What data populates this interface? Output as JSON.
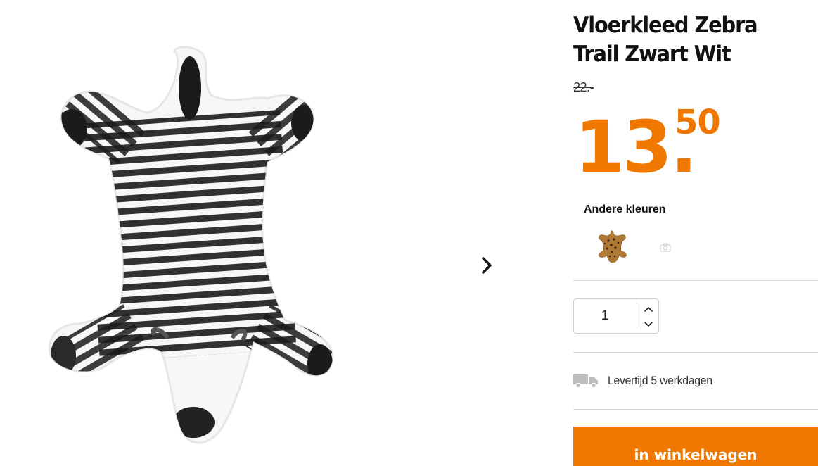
{
  "product": {
    "title": "Vloerkleed Zebra Trail Zwart Wit",
    "old_price": "22.-",
    "price_integer": "13.",
    "price_decimals": "50"
  },
  "colors": {
    "label": "Andere kleuren",
    "swatches": [
      {
        "name": "leopard"
      },
      {
        "name": "no-image"
      }
    ]
  },
  "quantity": {
    "value": "1"
  },
  "delivery": {
    "text": "Levertijd 5 werkdagen",
    "icon": "truck-icon"
  },
  "cart": {
    "button_label": "in winkelwagen"
  },
  "theme": {
    "accent": "#f07800"
  }
}
